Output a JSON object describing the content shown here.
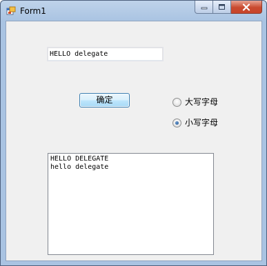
{
  "window": {
    "title": "Form1",
    "icon": "form-app-icon"
  },
  "caption_buttons": {
    "minimize_icon": "minimize-icon",
    "maximize_icon": "maximize-icon",
    "close_icon": "close-icon"
  },
  "input": {
    "value": "HELLO delegate"
  },
  "ok_button": {
    "label": "确定"
  },
  "radios": [
    {
      "label": "大写字母",
      "checked": false
    },
    {
      "label": "小写字母",
      "checked": true
    }
  ],
  "output": {
    "lines": [
      "HELLO DELEGATE",
      "hello delegate"
    ]
  },
  "colors": {
    "frame": "#a9c3e2",
    "client_bg": "#f0f0f0",
    "close_red": "#c94a2f",
    "button_border": "#3c7fb1"
  }
}
